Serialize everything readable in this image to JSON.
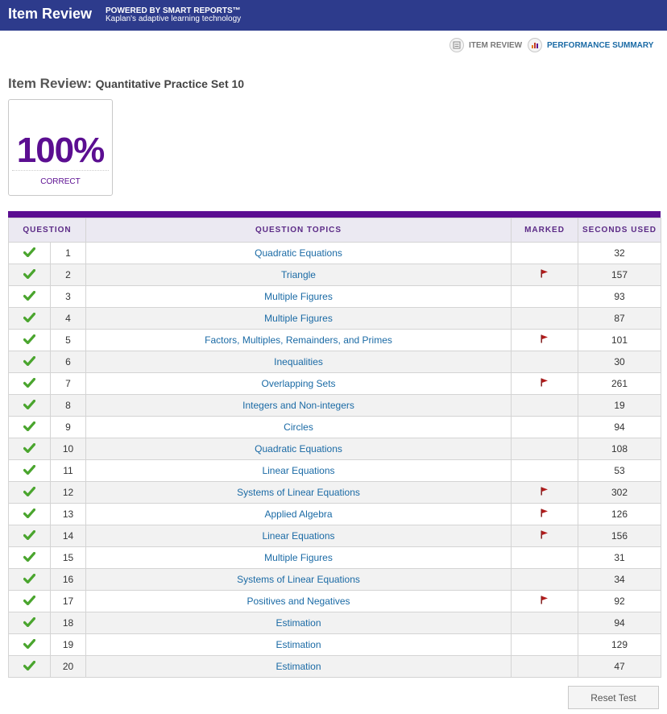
{
  "header": {
    "title": "Item Review",
    "powered_by": "POWERED BY SMART REPORTS™",
    "tagline": "Kaplan's adaptive learning technology",
    "background_color": "#2d3b8c"
  },
  "nav": {
    "item_review": {
      "label": "ITEM REVIEW",
      "icon": "list-icon"
    },
    "performance_summary": {
      "label": "PERFORMANCE SUMMARY",
      "icon": "bar-chart-icon"
    }
  },
  "page": {
    "title": "Item Review:",
    "subtitle": "Quantitative Practice Set 10"
  },
  "score": {
    "value": "100%",
    "label": "CORRECT",
    "color": "#5b0e91"
  },
  "table": {
    "headers": {
      "question": "QUESTION",
      "topics": "QUESTION TOPICS",
      "marked": "MARKED",
      "seconds": "SECONDS USED"
    },
    "rows": [
      {
        "correct": true,
        "num": "1",
        "topic": "Quadratic Equations",
        "marked": false,
        "seconds": "32"
      },
      {
        "correct": true,
        "num": "2",
        "topic": "Triangle",
        "marked": true,
        "seconds": "157"
      },
      {
        "correct": true,
        "num": "3",
        "topic": "Multiple Figures",
        "marked": false,
        "seconds": "93"
      },
      {
        "correct": true,
        "num": "4",
        "topic": "Multiple Figures",
        "marked": false,
        "seconds": "87"
      },
      {
        "correct": true,
        "num": "5",
        "topic": "Factors, Multiples, Remainders, and Primes",
        "marked": true,
        "seconds": "101"
      },
      {
        "correct": true,
        "num": "6",
        "topic": "Inequalities",
        "marked": false,
        "seconds": "30"
      },
      {
        "correct": true,
        "num": "7",
        "topic": "Overlapping Sets",
        "marked": true,
        "seconds": "261"
      },
      {
        "correct": true,
        "num": "8",
        "topic": "Integers and Non-integers",
        "marked": false,
        "seconds": "19"
      },
      {
        "correct": true,
        "num": "9",
        "topic": "Circles",
        "marked": false,
        "seconds": "94"
      },
      {
        "correct": true,
        "num": "10",
        "topic": "Quadratic Equations",
        "marked": false,
        "seconds": "108"
      },
      {
        "correct": true,
        "num": "11",
        "topic": "Linear Equations",
        "marked": false,
        "seconds": "53"
      },
      {
        "correct": true,
        "num": "12",
        "topic": "Systems of Linear Equations",
        "marked": true,
        "seconds": "302"
      },
      {
        "correct": true,
        "num": "13",
        "topic": "Applied Algebra",
        "marked": true,
        "seconds": "126"
      },
      {
        "correct": true,
        "num": "14",
        "topic": "Linear Equations",
        "marked": true,
        "seconds": "156"
      },
      {
        "correct": true,
        "num": "15",
        "topic": "Multiple Figures",
        "marked": false,
        "seconds": "31"
      },
      {
        "correct": true,
        "num": "16",
        "topic": "Systems of Linear Equations",
        "marked": false,
        "seconds": "34"
      },
      {
        "correct": true,
        "num": "17",
        "topic": "Positives and Negatives",
        "marked": true,
        "seconds": "92"
      },
      {
        "correct": true,
        "num": "18",
        "topic": "Estimation",
        "marked": false,
        "seconds": "94"
      },
      {
        "correct": true,
        "num": "19",
        "topic": "Estimation",
        "marked": false,
        "seconds": "129"
      },
      {
        "correct": true,
        "num": "20",
        "topic": "Estimation",
        "marked": false,
        "seconds": "47"
      }
    ]
  },
  "colors": {
    "check": "#4aa52e",
    "flag": "#b31b1b",
    "topic_link": "#1a6aa5",
    "accent": "#5b0e91"
  },
  "reset_button": {
    "label": "Reset Test"
  }
}
